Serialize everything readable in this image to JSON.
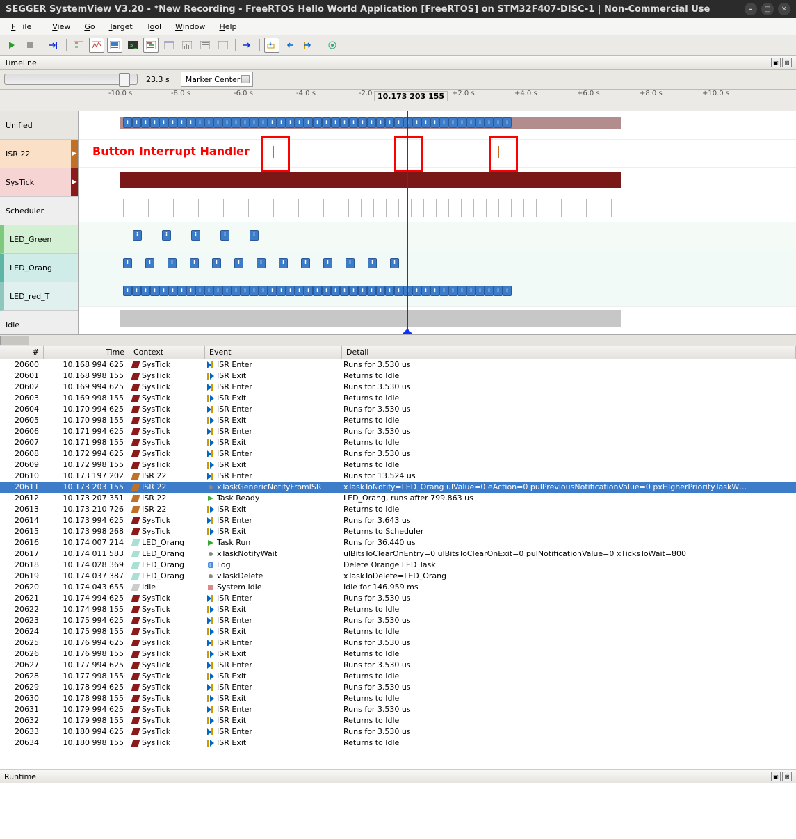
{
  "title": "SEGGER SystemView V3.20 - *New Recording - FreeRTOS Hello World Application [FreeRTOS] on STM32F407-DISC-1 | Non-Commercial Use",
  "menu": [
    "File",
    "View",
    "Go",
    "Target",
    "Tool",
    "Window",
    "Help"
  ],
  "timeline": {
    "title": "Timeline",
    "zoom_value": "23.3 s",
    "marker_mode": "Marker Center",
    "ruler": {
      "ticks": [
        "-10.0 s",
        "-8.0 s",
        "-6.0 s",
        "-4.0 s",
        "-2.0 s",
        "+2.0 s",
        "+4.0 s",
        "+6.0 s",
        "+8.0 s",
        "+10.0 s"
      ],
      "center": "10.173 203 155"
    },
    "tracks": [
      "Unified",
      "ISR 22",
      "SysTick",
      "Scheduler",
      "LED_Green",
      "LED_Orang",
      "LED_red_T",
      "Idle"
    ],
    "annotation": "Button Interrupt Handler"
  },
  "events": {
    "headers": [
      "#",
      "Time",
      "Context",
      "Event",
      "Detail"
    ],
    "rows": [
      {
        "n": "20600",
        "t": "10.168 994 625",
        "ctx": "SysTick",
        "ci": "systick",
        "ev": "ISR Enter",
        "ei": "enter",
        "d": "Runs for 3.530 us"
      },
      {
        "n": "20601",
        "t": "10.168 998 155",
        "ctx": "SysTick",
        "ci": "systick",
        "ev": "ISR Exit",
        "ei": "exit",
        "d": "Returns to Idle"
      },
      {
        "n": "20602",
        "t": "10.169 994 625",
        "ctx": "SysTick",
        "ci": "systick",
        "ev": "ISR Enter",
        "ei": "enter",
        "d": "Runs for 3.530 us"
      },
      {
        "n": "20603",
        "t": "10.169 998 155",
        "ctx": "SysTick",
        "ci": "systick",
        "ev": "ISR Exit",
        "ei": "exit",
        "d": "Returns to Idle"
      },
      {
        "n": "20604",
        "t": "10.170 994 625",
        "ctx": "SysTick",
        "ci": "systick",
        "ev": "ISR Enter",
        "ei": "enter",
        "d": "Runs for 3.530 us"
      },
      {
        "n": "20605",
        "t": "10.170 998 155",
        "ctx": "SysTick",
        "ci": "systick",
        "ev": "ISR Exit",
        "ei": "exit",
        "d": "Returns to Idle"
      },
      {
        "n": "20606",
        "t": "10.171 994 625",
        "ctx": "SysTick",
        "ci": "systick",
        "ev": "ISR Enter",
        "ei": "enter",
        "d": "Runs for 3.530 us"
      },
      {
        "n": "20607",
        "t": "10.171 998 155",
        "ctx": "SysTick",
        "ci": "systick",
        "ev": "ISR Exit",
        "ei": "exit",
        "d": "Returns to Idle"
      },
      {
        "n": "20608",
        "t": "10.172 994 625",
        "ctx": "SysTick",
        "ci": "systick",
        "ev": "ISR Enter",
        "ei": "enter",
        "d": "Runs for 3.530 us"
      },
      {
        "n": "20609",
        "t": "10.172 998 155",
        "ctx": "SysTick",
        "ci": "systick",
        "ev": "ISR Exit",
        "ei": "exit",
        "d": "Returns to Idle"
      },
      {
        "n": "20610",
        "t": "10.173 197 202",
        "ctx": "ISR 22",
        "ci": "isr22",
        "ev": "ISR Enter",
        "ei": "enter",
        "d": "Runs for 13.524 us"
      },
      {
        "n": "20611",
        "t": "10.173 203 155",
        "ctx": "ISR 22",
        "ci": "isr22",
        "ev": "xTaskGenericNotifyFromISR",
        "ei": "api",
        "d": "xTaskToNotify=LED_Orang ulValue=0 eAction=0 pulPreviousNotificationValue=0 pxHigherPriorityTaskW…",
        "sel": true
      },
      {
        "n": "20612",
        "t": "10.173 207 351",
        "ctx": "ISR 22",
        "ci": "isr22",
        "ev": "Task Ready",
        "ei": "ready",
        "d": "LED_Orang, runs after 799.863 us"
      },
      {
        "n": "20613",
        "t": "10.173 210 726",
        "ctx": "ISR 22",
        "ci": "isr22",
        "ev": "ISR Exit",
        "ei": "exit",
        "d": "Returns to Idle"
      },
      {
        "n": "20614",
        "t": "10.173 994 625",
        "ctx": "SysTick",
        "ci": "systick",
        "ev": "ISR Enter",
        "ei": "enter",
        "d": "Runs for 3.643 us"
      },
      {
        "n": "20615",
        "t": "10.173 998 268",
        "ctx": "SysTick",
        "ci": "systick",
        "ev": "ISR Exit",
        "ei": "exit",
        "d": "Returns to Scheduler"
      },
      {
        "n": "20616",
        "t": "10.174 007 214",
        "ctx": "LED_Orang",
        "ci": "ledorang",
        "ev": "Task Run",
        "ei": "run",
        "d": "Runs for 36.440 us"
      },
      {
        "n": "20617",
        "t": "10.174 011 583",
        "ctx": "LED_Orang",
        "ci": "ledorang",
        "ev": "xTaskNotifyWait",
        "ei": "api",
        "d": "ulBitsToClearOnEntry=0 ulBitsToClearOnExit=0 pulNotificationValue=0 xTicksToWait=800"
      },
      {
        "n": "20618",
        "t": "10.174 028 369",
        "ctx": "LED_Orang",
        "ci": "ledorang",
        "ev": "Log",
        "ei": "log",
        "d": "Delete Orange LED Task"
      },
      {
        "n": "20619",
        "t": "10.174 037 387",
        "ctx": "LED_Orang",
        "ci": "ledorang",
        "ev": "vTaskDelete",
        "ei": "api",
        "d": "xTaskToDelete=LED_Orang"
      },
      {
        "n": "20620",
        "t": "10.174 043 655",
        "ctx": "Idle",
        "ci": "idle",
        "ev": "System Idle",
        "ei": "idle",
        "d": "Idle for 146.959 ms"
      },
      {
        "n": "20621",
        "t": "10.174 994 625",
        "ctx": "SysTick",
        "ci": "systick",
        "ev": "ISR Enter",
        "ei": "enter",
        "d": "Runs for 3.530 us"
      },
      {
        "n": "20622",
        "t": "10.174 998 155",
        "ctx": "SysTick",
        "ci": "systick",
        "ev": "ISR Exit",
        "ei": "exit",
        "d": "Returns to Idle"
      },
      {
        "n": "20623",
        "t": "10.175 994 625",
        "ctx": "SysTick",
        "ci": "systick",
        "ev": "ISR Enter",
        "ei": "enter",
        "d": "Runs for 3.530 us"
      },
      {
        "n": "20624",
        "t": "10.175 998 155",
        "ctx": "SysTick",
        "ci": "systick",
        "ev": "ISR Exit",
        "ei": "exit",
        "d": "Returns to Idle"
      },
      {
        "n": "20625",
        "t": "10.176 994 625",
        "ctx": "SysTick",
        "ci": "systick",
        "ev": "ISR Enter",
        "ei": "enter",
        "d": "Runs for 3.530 us"
      },
      {
        "n": "20626",
        "t": "10.176 998 155",
        "ctx": "SysTick",
        "ci": "systick",
        "ev": "ISR Exit",
        "ei": "exit",
        "d": "Returns to Idle"
      },
      {
        "n": "20627",
        "t": "10.177 994 625",
        "ctx": "SysTick",
        "ci": "systick",
        "ev": "ISR Enter",
        "ei": "enter",
        "d": "Runs for 3.530 us"
      },
      {
        "n": "20628",
        "t": "10.177 998 155",
        "ctx": "SysTick",
        "ci": "systick",
        "ev": "ISR Exit",
        "ei": "exit",
        "d": "Returns to Idle"
      },
      {
        "n": "20629",
        "t": "10.178 994 625",
        "ctx": "SysTick",
        "ci": "systick",
        "ev": "ISR Enter",
        "ei": "enter",
        "d": "Runs for 3.530 us"
      },
      {
        "n": "20630",
        "t": "10.178 998 155",
        "ctx": "SysTick",
        "ci": "systick",
        "ev": "ISR Exit",
        "ei": "exit",
        "d": "Returns to Idle"
      },
      {
        "n": "20631",
        "t": "10.179 994 625",
        "ctx": "SysTick",
        "ci": "systick",
        "ev": "ISR Enter",
        "ei": "enter",
        "d": "Runs for 3.530 us"
      },
      {
        "n": "20632",
        "t": "10.179 998 155",
        "ctx": "SysTick",
        "ci": "systick",
        "ev": "ISR Exit",
        "ei": "exit",
        "d": "Returns to Idle"
      },
      {
        "n": "20633",
        "t": "10.180 994 625",
        "ctx": "SysTick",
        "ci": "systick",
        "ev": "ISR Enter",
        "ei": "enter",
        "d": "Runs for 3.530 us"
      },
      {
        "n": "20634",
        "t": "10.180 998 155",
        "ctx": "SysTick",
        "ci": "systick",
        "ev": "ISR Exit",
        "ei": "exit",
        "d": "Returns to Idle"
      }
    ]
  },
  "runtime": {
    "title": "Runtime"
  }
}
